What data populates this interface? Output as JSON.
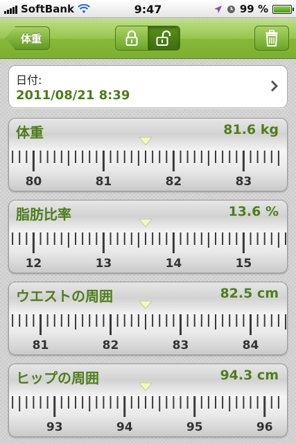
{
  "status_bar": {
    "carrier": "SoftBank",
    "time": "9:47",
    "battery_text": "99 %",
    "battery_level": 0.99
  },
  "nav": {
    "back_label": "体重",
    "segment": {
      "items": [
        "lock-icon",
        "unlock-icon"
      ],
      "selected_index": 1
    },
    "trash_icon": "trash-icon"
  },
  "date": {
    "label": "日付:",
    "value": "2011/08/21 8:39"
  },
  "colors": {
    "accent_green": "#4d7e1b",
    "nav_green": "#86b93a",
    "marker": "#f3f7c8"
  },
  "rulers": [
    {
      "name": "weight",
      "title": "体重",
      "value_text": "81.6 kg",
      "value": 81.6,
      "labels": [
        80,
        81,
        82,
        83
      ]
    },
    {
      "name": "body-fat",
      "title": "脂肪比率",
      "value_text": "13.6 %",
      "value": 13.6,
      "labels": [
        12,
        13,
        14,
        15
      ]
    },
    {
      "name": "waist",
      "title": "ウエストの周囲",
      "value_text": "82.5 cm",
      "value": 82.5,
      "labels": [
        81,
        82,
        83,
        84
      ]
    },
    {
      "name": "hip",
      "title": "ヒップの周囲",
      "value_text": "94.3 cm",
      "value": 94.3,
      "labels": [
        93,
        94,
        95,
        96
      ]
    }
  ]
}
